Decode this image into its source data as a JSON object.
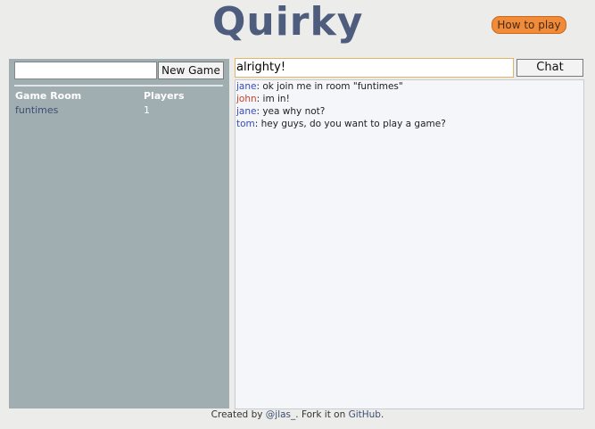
{
  "header": {
    "logo_text": "Quirky",
    "how_to_play_label": "How to play"
  },
  "lobby": {
    "new_game_input_value": "",
    "new_game_button_label": "New Game",
    "columns": [
      "Game Room",
      "Players"
    ],
    "rooms": [
      {
        "name": "funtimes",
        "players": "1"
      }
    ]
  },
  "chat": {
    "input_value": "alrighty!",
    "button_label": "Chat",
    "messages": [
      {
        "user": "jane",
        "text": ": ok join me in room \"funtimes\""
      },
      {
        "user": "john",
        "text": ": im in!"
      },
      {
        "user": "jane",
        "text": ": yea why not?"
      },
      {
        "user": "tom",
        "text": ": hey guys, do you want to play a game?"
      }
    ]
  },
  "footer": {
    "prefix": "Created by ",
    "author_link": "@jlas_",
    "middle": ". Fork it on ",
    "github_link": "GitHub",
    "suffix": "."
  },
  "colors": {
    "background": "#ececea",
    "logo": "#4e5c7d",
    "how_to_play_button": "#f08b3a",
    "lobby_panel": "#a0adb1",
    "chat_log": "#f4f6fa",
    "username_default": "#3a4bb5",
    "username_john": "#c8412a"
  }
}
